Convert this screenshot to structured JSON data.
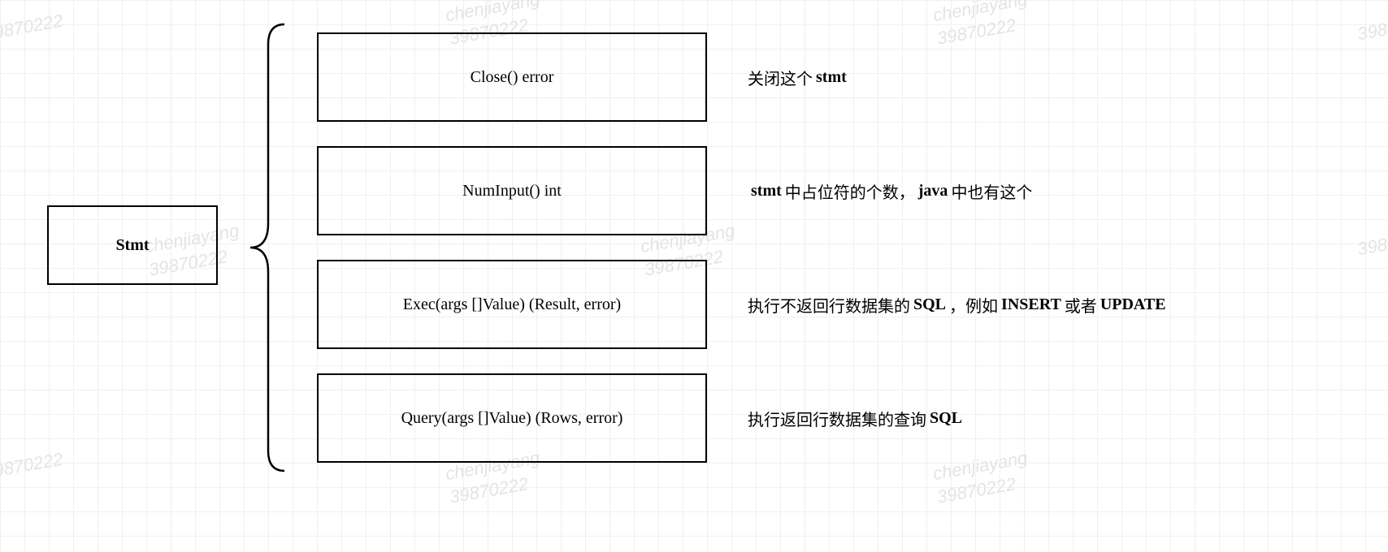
{
  "root": {
    "label": "Stmt"
  },
  "methods": [
    {
      "signature": "Close() error",
      "desc_pre": "关闭这个 ",
      "desc_mono1": "stmt",
      "desc_mid": "",
      "desc_mono2": "",
      "desc_post": ""
    },
    {
      "signature": "NumInput() int",
      "desc_pre": "",
      "desc_mono1": "stmt",
      "desc_mid": " 中占位符的个数，",
      "desc_mono2": "java",
      "desc_post": " 中也有这个"
    },
    {
      "signature": "Exec(args []Value) (Result, error)",
      "desc_pre": "执行不返回行数据集的 ",
      "desc_mono1": "SQL",
      "desc_mid": "，例如 ",
      "desc_mono2": "INSERT",
      "desc_post": " 或者 ",
      "desc_mono3": "UPDATE"
    },
    {
      "signature": "Query(args []Value) (Rows, error)",
      "desc_pre": "执行返回行数据集的查询 ",
      "desc_mono1": "SQL",
      "desc_mid": "",
      "desc_mono2": "",
      "desc_post": ""
    }
  ],
  "watermark": {
    "name": "chenjiayang",
    "id": "39870222"
  }
}
